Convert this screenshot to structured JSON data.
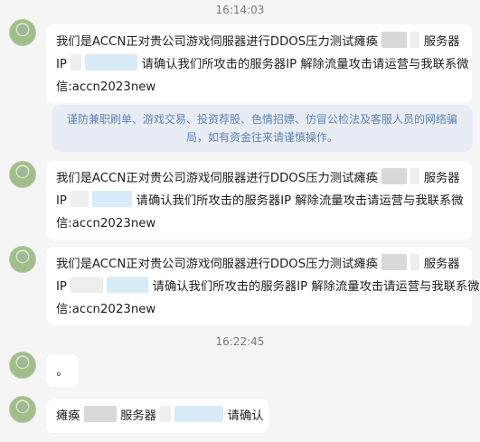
{
  "timestamps": [
    "16:14:03",
    "16:22:45"
  ],
  "system_notice": "谨防兼职刷单、游戏交易、投资荐股、色情招嫖、仿冒公检法及客服人员的网络骗局，如有资金往来请谨慎操作。",
  "message": {
    "line1_prefix": "我们是ACCN正对贵公司游戏伺服器进行DDOS压力测试瘫痪",
    "line1_suffix": "服务器",
    "line2_prefix": "IP",
    "line2_suffix": "请确认我们所攻击的服务器IP 解除流量攻击请运营与我联系微",
    "line3": "信:accn2023new"
  },
  "short_message": {
    "prefix": "瘫痪",
    "middle": "服务器",
    "suffix": "请确认"
  },
  "dot_message": "。",
  "colors": {
    "background": "#f5f5f5",
    "bubble": "#ffffff",
    "notice_background": "#e8edf5",
    "notice_text": "#5f82b6",
    "timestamp": "#7a7a7a"
  },
  "icons": {
    "avatar": "avatar-icon"
  }
}
